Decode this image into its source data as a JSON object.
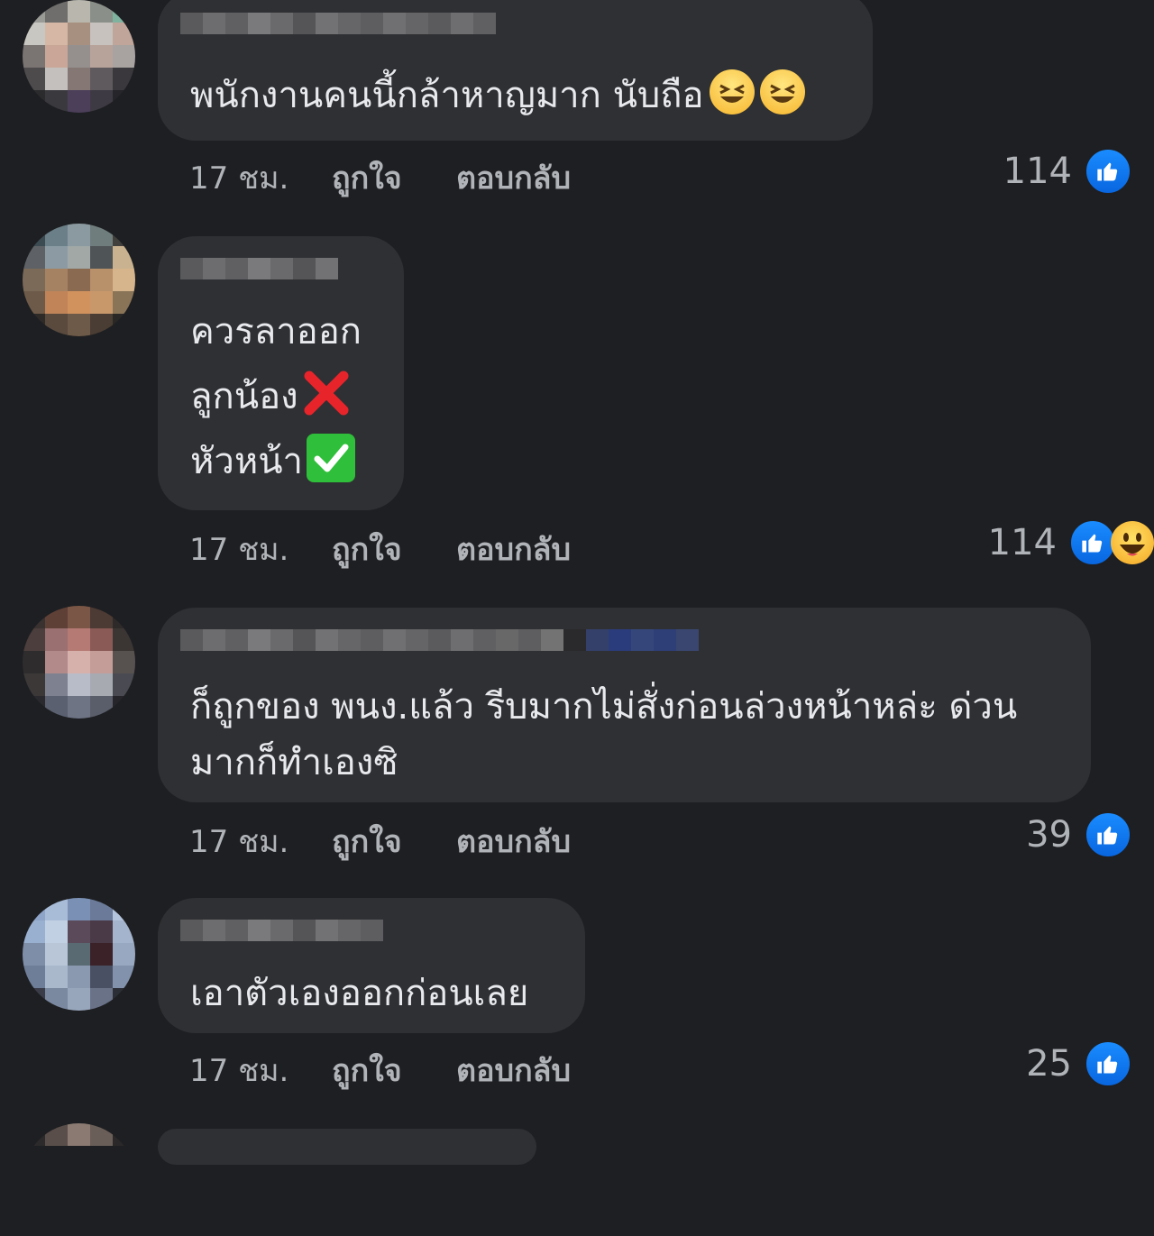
{
  "comments": [
    {
      "text_lines": [
        "พนักงานคนนี้กล้าหาญมาก นับถือ"
      ],
      "emoji": [
        "grinning-squinting-face",
        "grinning-squinting-face"
      ],
      "time": "17 ชม.",
      "like_label": "ถูกใจ",
      "reply_label": "ตอบกลับ",
      "reaction_count": "114",
      "reactions": [
        "like"
      ]
    },
    {
      "text_lines": [
        "ควรลาออก",
        "ลูกน้อง",
        "หัวหน้า"
      ],
      "line_emoji": [
        "",
        "cross-mark",
        "check-mark-button"
      ],
      "time": "17 ชม.",
      "like_label": "ถูกใจ",
      "reply_label": "ตอบกลับ",
      "reaction_count": "114",
      "reactions": [
        "like",
        "haha"
      ]
    },
    {
      "text_lines": [
        "ก็ถูกของ พนง.แล้ว รีบมากไม่สั่งก่อนล่วงหน้าหล่ะ ด่วน",
        "มากก็ทำเองซิ"
      ],
      "time": "17 ชม.",
      "like_label": "ถูกใจ",
      "reply_label": "ตอบกลับ",
      "reaction_count": "39",
      "reactions": [
        "like"
      ]
    },
    {
      "text_lines": [
        "เอาตัวเองออกก่อนเลย"
      ],
      "time": "17 ชม.",
      "like_label": "ถูกใจ",
      "reply_label": "ตอบกลับ",
      "reaction_count": "25",
      "reactions": [
        "like"
      ]
    }
  ],
  "colors": {
    "background": "#1e1f22",
    "bubble": "#2f3033",
    "meta_text": "#b0b3b8",
    "like_blue": "#0866ff"
  }
}
